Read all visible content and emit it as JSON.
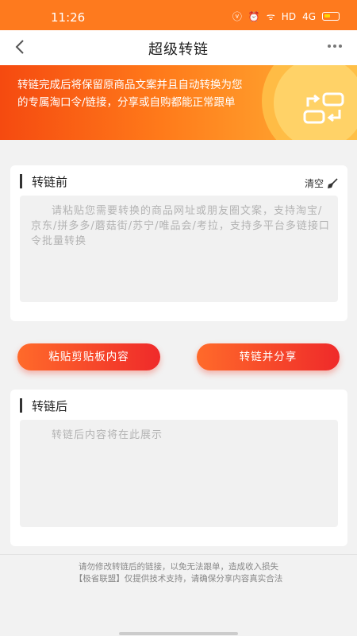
{
  "status_bar": {
    "time": "11:26",
    "network": "HD",
    "signal": "4G"
  },
  "nav": {
    "title": "超级转链",
    "back_icon": "chevron-left-icon",
    "more_icon": "more-dots-icon"
  },
  "banner": {
    "text": "转链完成后将保留原商品文案并且自动转换为您的专属淘口令/链接，分享或自购都能正常跟单",
    "icon": "swap-icon"
  },
  "before_card": {
    "title": "转链前",
    "clear_label": "清空",
    "clear_icon": "broom-icon",
    "placeholder": "请粘贴您需要转换的商品网址或朋友圈文案，支持淘宝/京东/拼多多/蘑菇街/苏宁/唯品会/考拉，支持多平台多链接口令批量转换"
  },
  "actions": {
    "paste_label": "粘贴剪贴板内容",
    "convert_label": "转链并分享"
  },
  "after_card": {
    "title": "转链后",
    "placeholder": "转链后内容将在此展示"
  },
  "footer": {
    "line1": "请勿修改转链后的链接，以免无法跟单，造成收入损失",
    "line2": "【极省联盟】仅提供技术支持，请确保分享内容真实合法"
  },
  "colors": {
    "accent": "#ff7a1a",
    "button_start": "#ff6a2a",
    "button_end": "#ef2a2a"
  }
}
